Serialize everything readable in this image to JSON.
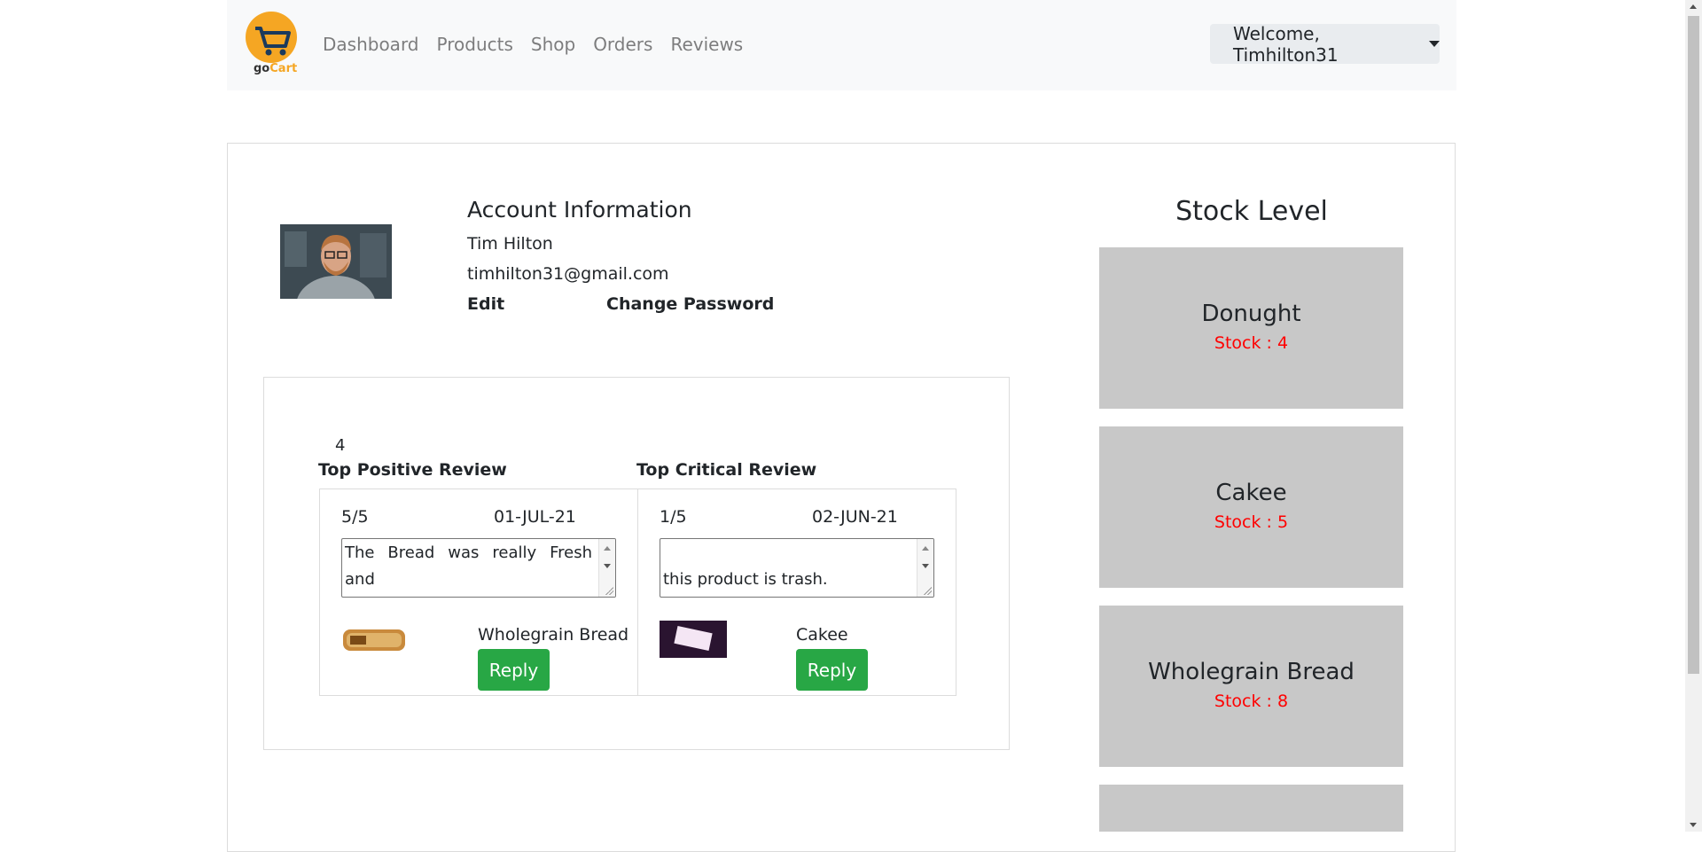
{
  "navbar": {
    "logo_text_go": "go",
    "logo_text_cart": "Cart",
    "links": [
      "Dashboard",
      "Products",
      "Shop",
      "Orders",
      "Reviews"
    ],
    "welcome": "Welcome, Timhilton31"
  },
  "account": {
    "title": "Account Information",
    "name": "Tim Hilton",
    "email": "timhilton31@gmail.com",
    "edit": "Edit",
    "change_password": "Change Password"
  },
  "reviews": {
    "count": "4",
    "positive": {
      "heading": "Top Positive Review",
      "rating": "5/5",
      "date": "01-JUL-21",
      "text": "The Bread was really Fresh and",
      "product": "Wholegrain Bread",
      "reply": "Reply"
    },
    "critical": {
      "heading": "Top Critical Review",
      "rating": "1/5",
      "date": "02-JUN-21",
      "text": "this product is trash.",
      "product": "Cakee",
      "reply": "Reply"
    }
  },
  "stock": {
    "title": "Stock Level",
    "items": [
      {
        "name": "Donught",
        "qty": "Stock : 4"
      },
      {
        "name": "Cakee",
        "qty": "Stock : 5"
      },
      {
        "name": "Wholegrain Bread",
        "qty": "Stock : 8"
      }
    ]
  }
}
